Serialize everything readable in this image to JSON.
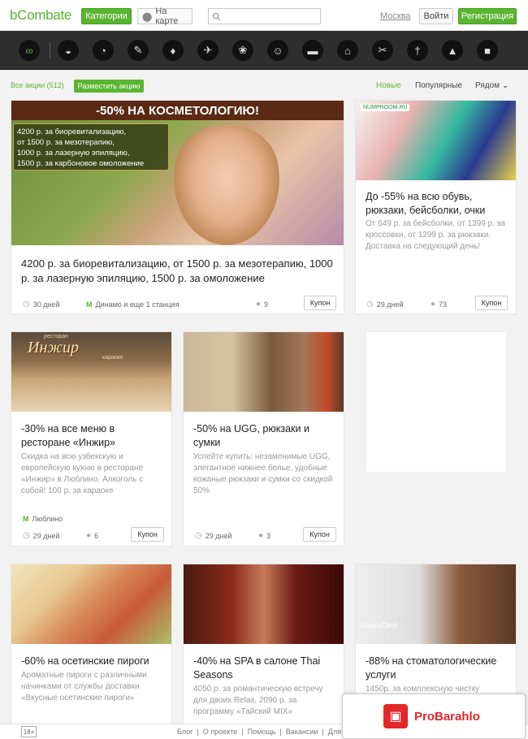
{
  "header": {
    "logo": "bCombate",
    "categories_button": "Категории",
    "map_button": "На карте",
    "search_placeholder": "",
    "city": "Москва",
    "login_button": "Войти",
    "register_button": "Регистрация"
  },
  "category_icons": [
    "all-deals-icon",
    "beauty-lips-icon",
    "fitness-icon",
    "health-icon",
    "clothes-icon",
    "travel-icon",
    "food-icon",
    "entertainment-icon",
    "auto-icon",
    "shopping-icon",
    "services-icon",
    "medicine-icon",
    "education-icon",
    "gifts-icon"
  ],
  "filters": {
    "all_deals": "Все акции (512)",
    "place_deal": "Разместить акцию",
    "sort_new": "Новые",
    "sort_popular": "Популярные",
    "sort_near": "Рядом"
  },
  "cards": [
    {
      "banner": "-50% НА КОСМЕТОЛОГИЮ!",
      "banner_lines": [
        "4200 р. за биоревитализацию,",
        "от 1500 р. за мезотерапию,",
        "1000 р. за лазерную эпиляцию,",
        "1500 р. за карбоновое омоложение"
      ],
      "title": "4200 р. за биоревитализацию, от 1500 р. за мезотерапию, 1000 р. за лазерную эпиляцию, 1500 р. за омоложение",
      "days": "30 дней",
      "metro": "Динамо и еще 1 станция",
      "people": "9",
      "coupon": "Купон"
    },
    {
      "banner": "NUMPROOM.RU",
      "title": "До -55% на всю обувь, рюкзаки, бейсболки, очки",
      "desc": "От 649 р. за бейсболки, от 1399 р. за кроссовки, от 1299 р. за рюкзаки. Доставка на следующий день!",
      "days": "29 дней",
      "people": "73",
      "coupon": "Купон"
    },
    {
      "banner": "Инжир",
      "banner_small": "ресторан",
      "banner_small2": "караоке",
      "title": "-30% на все меню в ресторане «Инжир»",
      "desc": "Скидка на всю узбекскую и европейскую кухню в ресторане «Инжир» в Люблино. Алкоголь с собой! 100 р. за караоке",
      "metro": "Люблино",
      "days": "29 дней",
      "people": "6",
      "coupon": "Купон"
    },
    {
      "title": "-50% на UGG, рюкзаки и сумки",
      "desc": "Успейте купить: незаменимые UGG, элегантное нижнее белье, удобные кожаные рюкзаки и сумки со скидкой 50%",
      "days": "29 дней",
      "people": "3",
      "coupon": "Купон"
    },
    {
      "title": "-60% на осетинские пироги",
      "desc": "Ароматные пироги с различными начинками от службы доставки «Вкусные осетинские пироги»"
    },
    {
      "title": "-40% на SPA в салоне Thai Seasons",
      "desc": "4050 р. за романтическую встречу для двоих Relax, 2090 р. за программу «Тайский MIX»"
    },
    {
      "banner": "HappyDent",
      "title": "-88% на стоматологические услуги",
      "desc": "1450р. за комплексную чистку"
    }
  ],
  "footer": {
    "age": "18+",
    "links": [
      "Блог",
      "|",
      "О проекте",
      "|",
      "Помощь",
      "|",
      "Вакансии",
      "|",
      "Для"
    ]
  },
  "probarahlo": "ProBarahlo",
  "colors": {
    "accent": "#5cb531",
    "dark_bar": "#2e2e2e",
    "probarahlo_red": "#e3272b"
  }
}
